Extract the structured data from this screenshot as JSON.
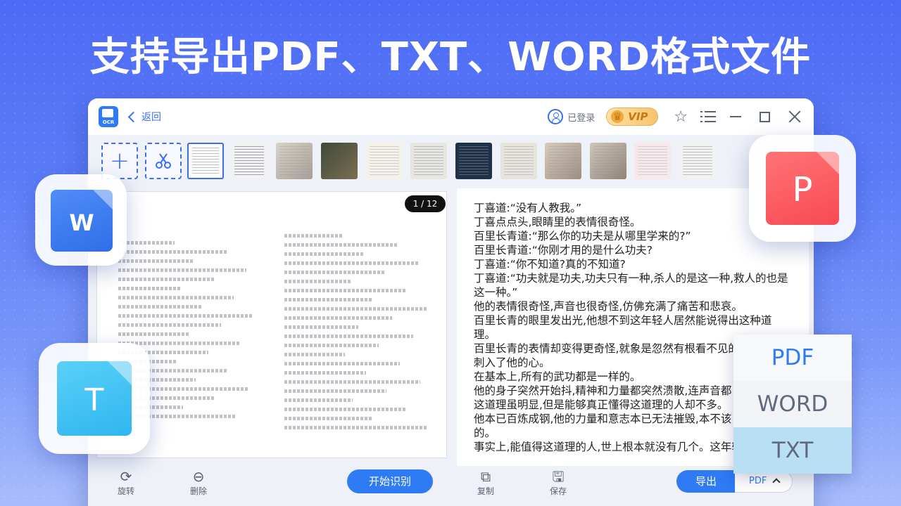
{
  "headline": "支持导出PDF、TXT、WORD格式文件",
  "window": {
    "back_label": "返回",
    "logo_text": "OCR",
    "login_label": "已登录",
    "vip_label": "VIP",
    "page_indicator": "1 / 12"
  },
  "ocr_lines": [
    "丁喜道:“没有人教我。”",
    "丁喜点点头,眼睛里的表情很奇怪。",
    "百里长青道:“那么你的功夫是从哪里学来的?”",
    "百里长青道:“你刚才用的是什么功夫?",
    "丁喜道:“你不知道?真的不知道?",
    "丁喜道:“功夫就是功夫,功夫只有一种,杀人的是这一种,救人的也是",
    "这一种。”",
    "他的表情很奇怪,声音也很奇怪,仿佛充满了痛苦和悲哀。",
    "百里长青的眼里发出光,他想不到这年轻人居然能说得出这种道",
    "理。",
    "百里长青的表情却变得更奇怪,就象是忽然有根看不见的",
    "刺入了他的心。",
    "在基本上,所有的武功都是一样的。",
    "他的身子突然开始抖,精神和力量都突然溃散,连声音都",
    "这道理虽明显,但是能够真正懂得这道理的人却不多。",
    "他本已百炼成钢,他的力量和意志本已无法摧毁,本不该",
    "的。",
    "事实上,能值得这道理的人,世上根本就没有几个。这年轻"
  ],
  "left_tools": {
    "rotate": "旋转",
    "delete": "删除",
    "start": "开始识别"
  },
  "right_tools": {
    "copy": "复制",
    "save": "保存",
    "export": "导出",
    "format": "PDF"
  },
  "dropdown": {
    "options": [
      "PDF",
      "WORD",
      "TXT"
    ],
    "selected": "PDF",
    "hovered": "TXT"
  },
  "badges": {
    "word": "W",
    "txt": "T",
    "pdf": "P"
  },
  "colors": {
    "accent": "#2f7bf5",
    "pdf": "#ff5a5f",
    "word": "#3b7cf0",
    "txt": "#3ec3f5"
  }
}
